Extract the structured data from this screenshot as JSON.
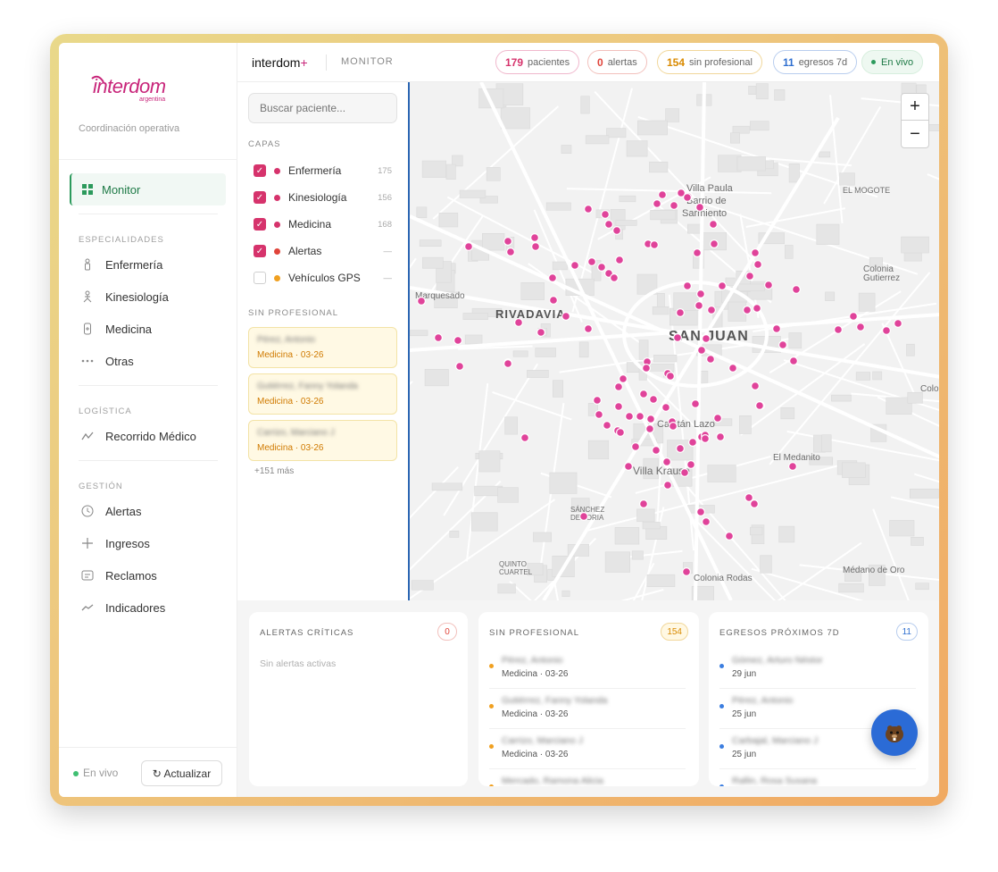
{
  "brand": {
    "logo_text": "interdom",
    "logo_sub": "argentina",
    "subtitle": "Coordinación operativa"
  },
  "sidebar": {
    "active": {
      "label": "Monitor",
      "icon": "grid-icon"
    },
    "sections": {
      "especialidades": "ESPECIALIDADES",
      "logistica": "LOGÍSTICA",
      "gestion": "GESTIÓN"
    },
    "especialidades": [
      {
        "label": "Enfermería",
        "icon": "nurse-icon"
      },
      {
        "label": "Kinesiología",
        "icon": "person-icon"
      },
      {
        "label": "Medicina",
        "icon": "medicine-icon"
      },
      {
        "label": "Otras",
        "icon": "dots-icon"
      }
    ],
    "logistica": [
      {
        "label": "Recorrido Médico",
        "icon": "route-icon"
      }
    ],
    "gestion": [
      {
        "label": "Alertas",
        "icon": "clock-icon"
      },
      {
        "label": "Ingresos",
        "icon": "plus-icon"
      },
      {
        "label": "Reclamos",
        "icon": "message-icon"
      },
      {
        "label": "Indicadores",
        "icon": "trend-icon"
      }
    ],
    "live_label": "En vivo",
    "refresh_label": "↻ Actualizar"
  },
  "header": {
    "app_name": "interdom",
    "app_plus": "+",
    "section": "MONITOR",
    "stats": [
      {
        "value": "179",
        "label": "pacientes",
        "color": "#d6336c",
        "border": "#f0b7cc"
      },
      {
        "value": "0",
        "label": "alertas",
        "color": "#e0443a",
        "border": "#f2c0bc"
      },
      {
        "value": "154",
        "label": "sin profesional",
        "color": "#d98a00",
        "border": "#f1d79a"
      },
      {
        "value": "11",
        "label": "egresos 7d",
        "color": "#2f6fd0",
        "border": "#b8cdee"
      }
    ],
    "live": "En vivo"
  },
  "panel": {
    "search_placeholder": "Buscar paciente...",
    "layers_title": "CAPAS",
    "layers": [
      {
        "label": "Enfermería",
        "count": "175",
        "checked": true,
        "color": "#d6336c"
      },
      {
        "label": "Kinesiología",
        "count": "156",
        "checked": true,
        "color": "#d6336c"
      },
      {
        "label": "Medicina",
        "count": "168",
        "checked": true,
        "color": "#d6336c"
      },
      {
        "label": "Alertas",
        "count": "—",
        "checked": true,
        "color": "#e0443a"
      },
      {
        "label": "Vehículos GPS",
        "count": "—",
        "checked": false,
        "color": "#f0a020"
      }
    ],
    "unassigned_title": "SIN PROFESIONAL",
    "unassigned": [
      {
        "name": "Pérez, Antonio",
        "meta": "Medicina · 03-26"
      },
      {
        "name": "Gutiérrez, Fanny Yolanda",
        "meta": "Medicina · 03-26"
      },
      {
        "name": "Carrizo, Marciano J",
        "meta": "Medicina · 03-26"
      }
    ],
    "more": "+151 más"
  },
  "map": {
    "labels": [
      {
        "text": "Villa Paula",
        "size": 11
      },
      {
        "text": "Barrio de",
        "size": 11
      },
      {
        "text": "Sarmiento",
        "size": 11
      },
      {
        "text": "EL MOGOTE",
        "size": 9
      },
      {
        "text": "Colonia",
        "size": 10
      },
      {
        "text": "Gutierrez",
        "size": 10
      },
      {
        "text": "Marquesado",
        "size": 10
      },
      {
        "text": "RIVADAVIA",
        "size": 13
      },
      {
        "text": "SAN JUAN",
        "size": 16
      },
      {
        "text": "Colo",
        "size": 10
      },
      {
        "text": "Capitán Lazo",
        "size": 11
      },
      {
        "text": "Villa Krause",
        "size": 12
      },
      {
        "text": "El Medanito",
        "size": 10
      },
      {
        "text": "SÁNCHEZ",
        "size": 8
      },
      {
        "text": "DE LORIA",
        "size": 8
      },
      {
        "text": "QUINTO",
        "size": 8
      },
      {
        "text": "CUARTEL",
        "size": 8
      },
      {
        "text": "Colonia Rodas",
        "size": 10
      },
      {
        "text": "Médano de Oro",
        "size": 10
      }
    ],
    "marker_color": "#e0439a",
    "zoom_in": "+",
    "zoom_out": "−"
  },
  "cards": {
    "alerts": {
      "title": "ALERTAS CRÍTICAS",
      "count": "0",
      "empty": "Sin alertas activas"
    },
    "unassigned": {
      "title": "SIN PROFESIONAL",
      "count": "154",
      "rows": [
        {
          "name": "Pérez, Antonio",
          "meta": "Medicina · 03-26"
        },
        {
          "name": "Gutiérrez, Fanny Yolanda",
          "meta": "Medicina · 03-26"
        },
        {
          "name": "Carrizo, Marciano J",
          "meta": "Medicina · 03-26"
        },
        {
          "name": "Mercado, Ramona Alicia",
          "meta": ""
        }
      ]
    },
    "discharges": {
      "title": "EGRESOS PRÓXIMOS 7D",
      "count": "11",
      "rows": [
        {
          "name": "Gómez, Arturo Néstor",
          "meta": "29 jun"
        },
        {
          "name": "Pérez, Antonio",
          "meta": "25 jun"
        },
        {
          "name": "Carbajal, Marciano J",
          "meta": "25 jun"
        },
        {
          "name": "Rallin, Rosa Susana",
          "meta": ""
        }
      ]
    }
  },
  "fab_icon": "beaver-assistant-icon"
}
